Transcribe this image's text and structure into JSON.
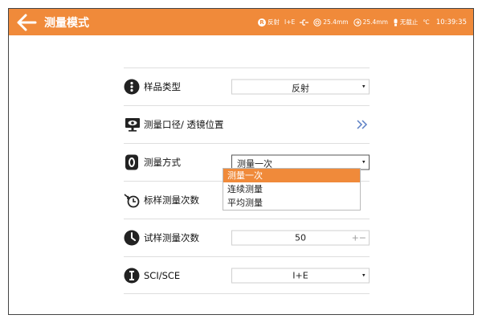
{
  "header": {
    "title": "测量模式",
    "back_icon": "arrow-left-icon",
    "accent_color": "#F08A3A"
  },
  "status_bar": {
    "mode_badge": "R",
    "mode_label": "反射",
    "specular": "I+E",
    "aperture": "25.4mm",
    "lens_position": "25.4mm",
    "uv_label": "无截止",
    "temp_unit": "℃",
    "time": "10:39:35"
  },
  "rows": {
    "sample_type": {
      "label": "样品类型",
      "value": "反射",
      "icon": "dots-vertical-icon"
    },
    "aperture_lens": {
      "label": "测量口径/ 透镜位置",
      "icon": "monitor-eye-icon",
      "action_icon": "double-chevron-right-icon"
    },
    "measure_method": {
      "label": "测量方式",
      "value": "测量一次",
      "icon": "zero-badge-icon"
    },
    "standard_count": {
      "label": "标样测量次数",
      "icon": "timer-arrow-icon"
    },
    "trial_count": {
      "label": "试样测量次数",
      "value": "50",
      "stepper": "+−",
      "icon": "clock-icon"
    },
    "sci_sce": {
      "label": "SCI/SCE",
      "value": "I+E",
      "icon": "info-bar-icon"
    }
  },
  "dropdown": {
    "options": [
      "测量一次",
      "连续测量",
      "平均测量"
    ],
    "selected_index": 0
  }
}
